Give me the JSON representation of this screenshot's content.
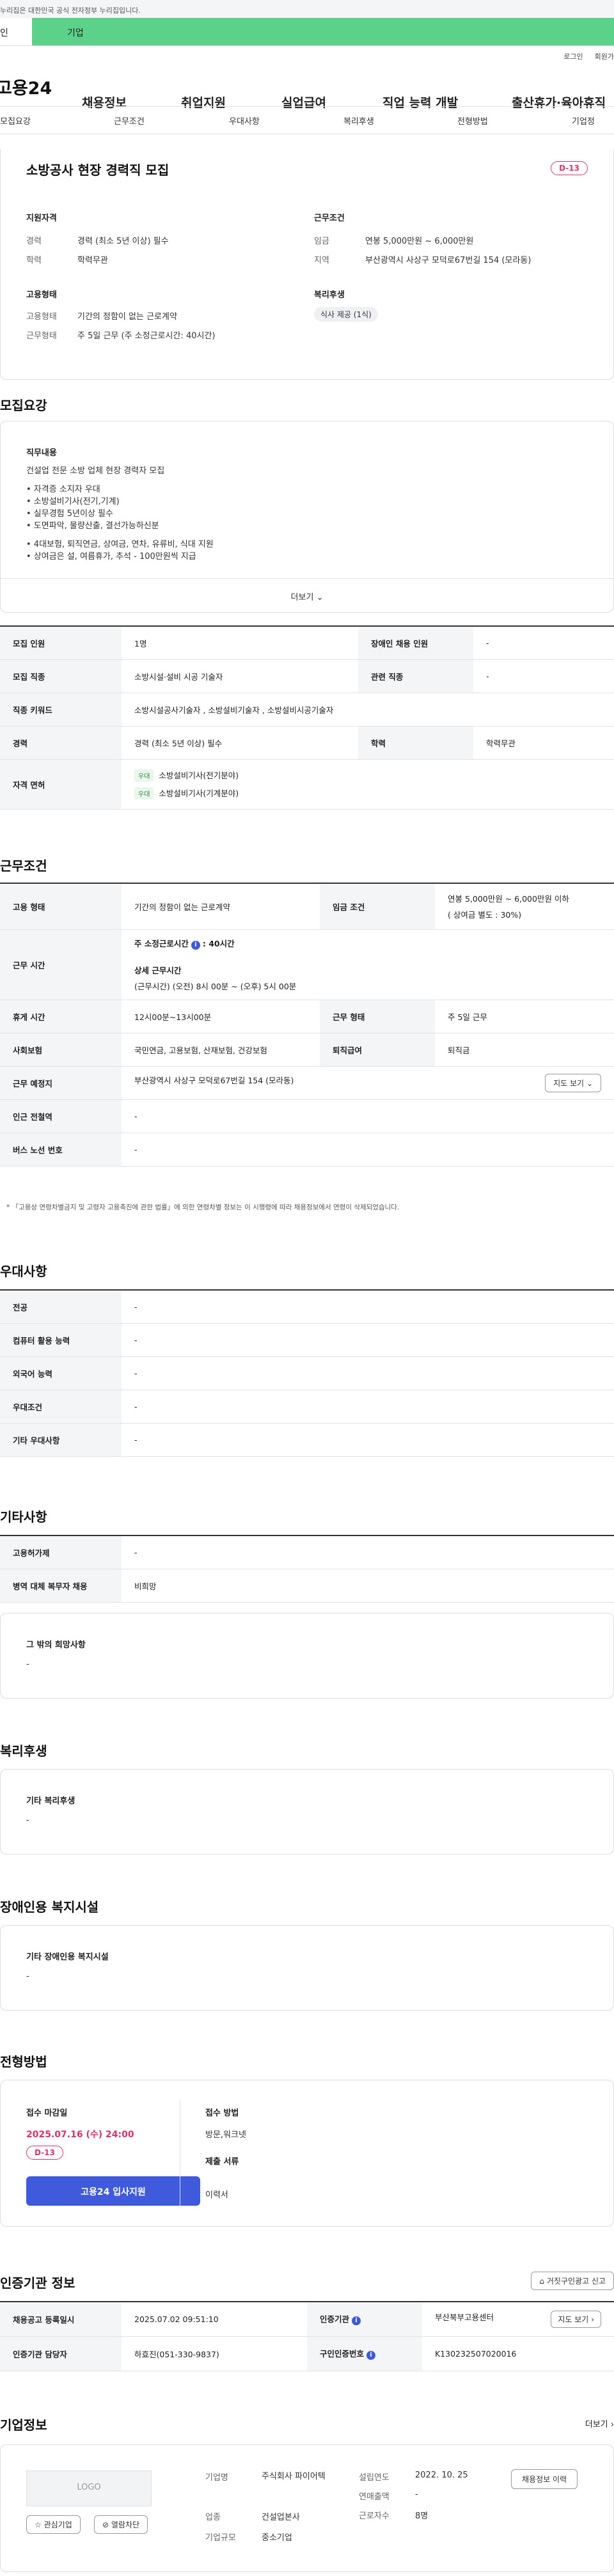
{
  "gov_banner": "누리집은 대한민국 공식 전자정부 누리집입니다.",
  "user_tabs": [
    "인",
    "기업"
  ],
  "login_links": [
    "로그인",
    "회원가"
  ],
  "gnb": {
    "logo": "고용24",
    "menus": [
      "채용정보",
      "취업지원",
      "실업급여",
      "직업 능력 개발",
      "출산휴가·육아휴직"
    ]
  },
  "sub_tabs": [
    "모집요강",
    "근무조건",
    "우대사항",
    "복리후생",
    "전형방법",
    "기업정"
  ],
  "summary": {
    "title": "소방공사 현장 경력직 모집",
    "dday": "D-13",
    "qual_heading": "지원자격",
    "qual": [
      {
        "k": "경력",
        "v": "경력 (최소 5년 이상) 필수"
      },
      {
        "k": "학력",
        "v": "학력무관"
      }
    ],
    "cond_heading": "근무조건",
    "cond": [
      {
        "k": "임금",
        "v": "연봉 5,000만원 ~ 6,000만원"
      },
      {
        "k": "지역",
        "v": "부산광역시 사상구 모덕로67번길 154 (모라동)"
      }
    ],
    "emp_heading": "고용형태",
    "emp": [
      {
        "k": "고용형태",
        "v": "기간의 정함이 없는 근로계약"
      },
      {
        "k": "근무형태",
        "v": "주 5일 근무 (주 소정근로시간: 40시간)"
      }
    ],
    "welfare_heading": "복리후생",
    "welfare_tag": "식사 제공 (1식)"
  },
  "recruit": {
    "section": "모집요강",
    "duty_heading": "직무내용",
    "duty_lines": [
      "건설업 전문 소방 업체 현장 경력자 모집",
      "• 자격증 소지자 우대",
      "• 소방설비기사(전기,기계)",
      "• 실무경험 5년이상 필수",
      "• 도면파악, 물량산출, 결선가능하신분",
      "• 4대보험, 퇴직연금, 상여금, 연차, 유류비, 식대 지원",
      "• 상여금은 설, 여름휴가, 추석 - 100만원씩 지급"
    ],
    "more": "더보기",
    "table": {
      "r1": {
        "k1": "모집 인원",
        "v1": "1명",
        "k2": "장애인 채용 인원",
        "v2": "-"
      },
      "r2": {
        "k1": "모집 직종",
        "v1": "소방시설·설비 시공 기술자",
        "k2": "관련 직종",
        "v2": "-"
      },
      "r3": {
        "k1": "직종 키워드",
        "v1": "소방시설공사기술자 , 소방설비기술자 , 소방설비시공기술자"
      },
      "r4": {
        "k1": "경력",
        "v1": "경력 (최소 5년 이상) 필수",
        "k2": "학력",
        "v2": "학력무관"
      },
      "r5": {
        "k1": "자격 면허",
        "chip": "우대",
        "l1": "소방설비기사(전기분야)",
        "l2": "소방설비기사(기계분야)"
      }
    }
  },
  "work": {
    "section": "근무조건",
    "r1": {
      "k1": "고용 형태",
      "v1": "기간의 정함이 없는 근로계약",
      "k2": "임금 조건",
      "v2a": "연봉 5,000만원 ~ 6,000만원 이하",
      "v2b": "( 상여금 별도 : 30%)"
    },
    "r2": {
      "k1": "근무 시간",
      "a": "주 소정근로시간",
      "b": ": 40시간",
      "c": "상세 근무시간",
      "d": "(근무시간) (오전) 8시 00분 ~ (오후) 5시 00분"
    },
    "r3": {
      "k1": "휴게 시간",
      "v1": "12시00분~13시00분",
      "k2": "근무 형태",
      "v2": "주 5일 근무"
    },
    "r4": {
      "k1": "사회보험",
      "v1": "국민연금, 고용보험, 산재보험, 건강보험",
      "k2": "퇴직급여",
      "v2": "퇴직금"
    },
    "r5": {
      "k1": "근무 예정지",
      "v1": "부산광역시 사상구 모덕로67번길 154 (모라동)",
      "btn": "지도 보기"
    },
    "r6": {
      "k1": "인근 전철역",
      "v1": "-"
    },
    "r7": {
      "k1": "버스 노선 번호",
      "v1": "-"
    },
    "note": "* 「고용상 연령차별금지 및 고령자 고용촉진에 관한 법률」에 의한 연령차별 정보는 이 시행령에 따라 채용정보에서 연령이 삭제되었습니다."
  },
  "pref": {
    "section": "우대사항",
    "rows": [
      {
        "k": "전공",
        "v": "-"
      },
      {
        "k": "컴퓨터 활용 능력",
        "v": "-"
      },
      {
        "k": "외국어 능력",
        "v": "-"
      },
      {
        "k": "우대조건",
        "v": "-"
      },
      {
        "k": "기타 우대사항",
        "v": "-"
      }
    ]
  },
  "etc": {
    "section": "기타사항",
    "rows": [
      {
        "k": "고용허가제",
        "v": "-"
      },
      {
        "k": "병역 대체 복무자 채용",
        "v": "비희망"
      }
    ],
    "box_title": "그 밖의 희망사항",
    "box_val": "-"
  },
  "benefit": {
    "section": "복리후생",
    "box_title": "기타 복리후생",
    "box_val": "-"
  },
  "disabled": {
    "section": "장애인용 복지시설",
    "box_title": "기타 장애인용 복지시설",
    "box_val": "-"
  },
  "select": {
    "section": "전형방법",
    "deadline_label": "접수 마감일",
    "deadline": "2025.07.16 (수) 24:00",
    "dday": "D-13",
    "apply": "고용24 입사지원",
    "method_label": "접수 방법",
    "method": "방문,워크넷",
    "docs_label": "제출 서류",
    "docs": "이력서"
  },
  "agency": {
    "section": "인증기관 정보",
    "report": "거짓구인광고 신고",
    "r1": {
      "k1": "채용공고 등록일시",
      "v1": "2025.07.02 09:51:10",
      "k2": "인증기관",
      "v2": "부산북부고용센터",
      "btn": "지도 보기"
    },
    "r2": {
      "k1": "인증기관 담당자",
      "v1": "하효진(051-330-9837)",
      "k2": "구인인증번호",
      "v2": "K130232507020016"
    }
  },
  "company": {
    "section": "기업정보",
    "more": "더보기",
    "logo": "LOGO",
    "fav": "관심기업",
    "block": "열람차단",
    "k1": "기업명",
    "v1": "주식회사 파이어텍",
    "k2": "업종",
    "v2": "건설업본사",
    "k3": "기업규모",
    "v3": "중소기업",
    "k4": "설립연도",
    "v4": "2022. 10. 25",
    "k5": "연매출액",
    "v5": "-",
    "k6": "근로자수",
    "v6": "8명",
    "btn": "채용정보 이력"
  }
}
